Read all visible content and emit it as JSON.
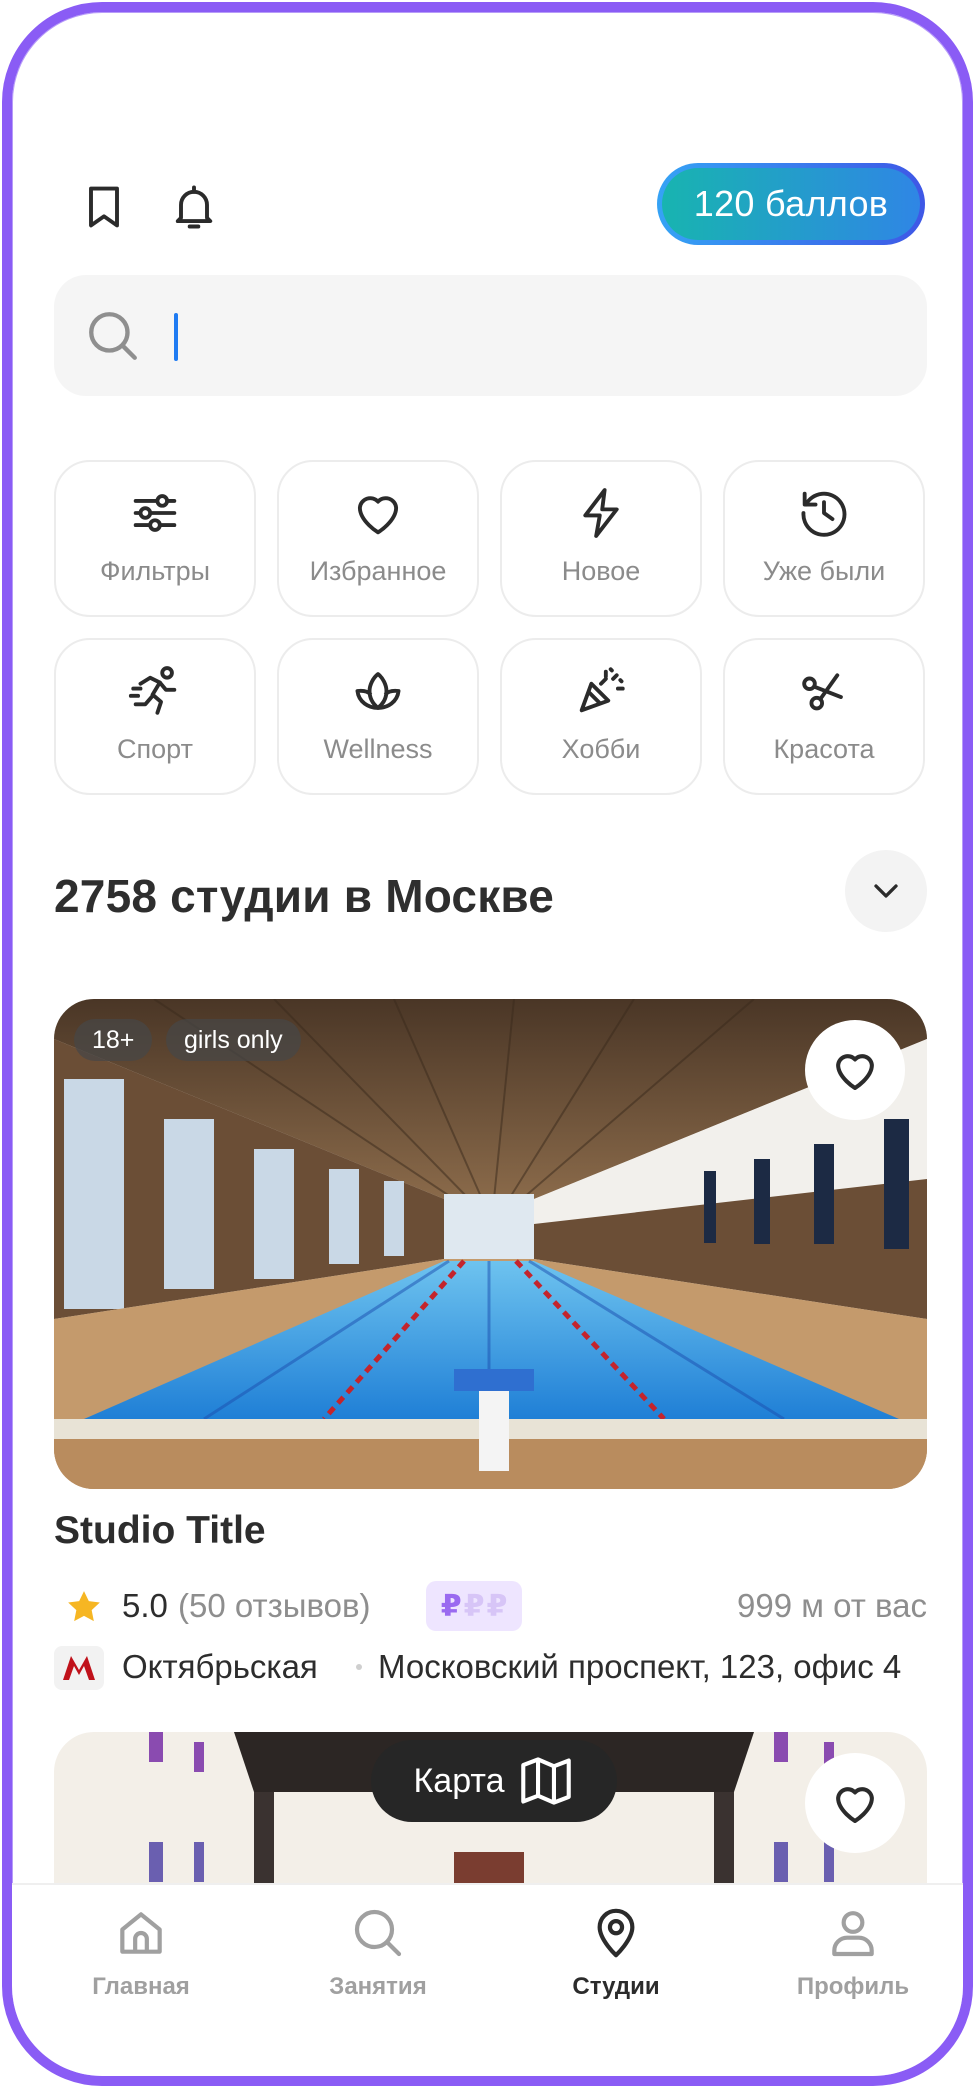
{
  "header": {
    "points_label": "120 баллов",
    "icons": [
      "bookmark-icon",
      "bell-icon"
    ]
  },
  "search": {
    "placeholder": "",
    "value": ""
  },
  "categories": [
    {
      "label": "Фильтры",
      "icon": "sliders-icon"
    },
    {
      "label": "Избранное",
      "icon": "heart-icon"
    },
    {
      "label": "Новое",
      "icon": "lightning-icon"
    },
    {
      "label": "Уже были",
      "icon": "history-icon"
    },
    {
      "label": "Спорт",
      "icon": "runner-icon"
    },
    {
      "label": "Wellness",
      "icon": "lotus-icon"
    },
    {
      "label": "Хобби",
      "icon": "party-popper-icon"
    },
    {
      "label": "Красота",
      "icon": "scissors-icon"
    }
  ],
  "results": {
    "heading": "2758 студии в Москве"
  },
  "studio_card": {
    "badges": [
      "18+",
      "girls only"
    ],
    "title": "Studio Title",
    "rating": "5.0",
    "reviews": "(50 отзывов)",
    "price_level": 1,
    "price_symbols": [
      "₽",
      "₽",
      "₽"
    ],
    "distance": "999 м от вас",
    "metro": "Октябрьская",
    "address": "Московский проспект, 123, офис 4"
  },
  "map_button": {
    "label": "Карта"
  },
  "tabbar": {
    "tabs": [
      {
        "label": "Главная",
        "icon": "home-icon",
        "active": false
      },
      {
        "label": "Занятия",
        "icon": "search-icon",
        "active": false
      },
      {
        "label": "Студии",
        "icon": "map-pin-icon",
        "active": true
      },
      {
        "label": "Профиль",
        "icon": "user-icon",
        "active": false
      }
    ]
  },
  "colors": {
    "frame": "#8a5cf5",
    "points_gradient_start": "#18b4b0",
    "points_gradient_end": "#2f86e5",
    "price_active": "#9a6af0",
    "metro_red": "#c0121b"
  }
}
